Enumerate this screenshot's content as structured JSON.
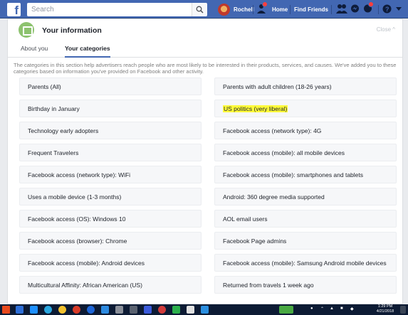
{
  "topbar": {
    "search_placeholder": "Search",
    "profile_name": "Rochell",
    "nav_home": "Home",
    "nav_find_friends": "Find Friends",
    "accent": "#4267b2"
  },
  "card": {
    "title": "Your information",
    "close_label": "Close ^",
    "tabs": [
      {
        "label": "About you",
        "active": false
      },
      {
        "label": "Your categories",
        "active": true
      }
    ],
    "description": "The categories in this section help advertisers reach people who are most likely to be interested in their products, services, and causes. We've added you to these categories based on information you've provided on Facebook and other activity."
  },
  "categories": [
    "Parents (All)",
    "Parents with adult children (18-26 years)",
    "Birthday in January",
    "US politics (very liberal)",
    "Technology early adopters",
    "Facebook access (network type): 4G",
    "Frequent Travelers",
    "Facebook access (mobile): all mobile devices",
    "Facebook access (network type): WiFi",
    "Facebook access (mobile): smartphones and tablets",
    "Uses a mobile device (1-3 months)",
    "Android: 360 degree media supported",
    "Facebook access (OS): Windows 10",
    "AOL email users",
    "Facebook access (browser): Chrome",
    "Facebook Page admins",
    "Facebook access (mobile): Android devices",
    "Facebook access (mobile): Samsung Android mobile devices",
    "Multicultural Affinity: African American (US)",
    "Returned from travels 1 week ago"
  ],
  "highlight_color": "#fffb3a",
  "taskbar": {
    "time": "1:29 PM",
    "date": "4/21/2018"
  }
}
